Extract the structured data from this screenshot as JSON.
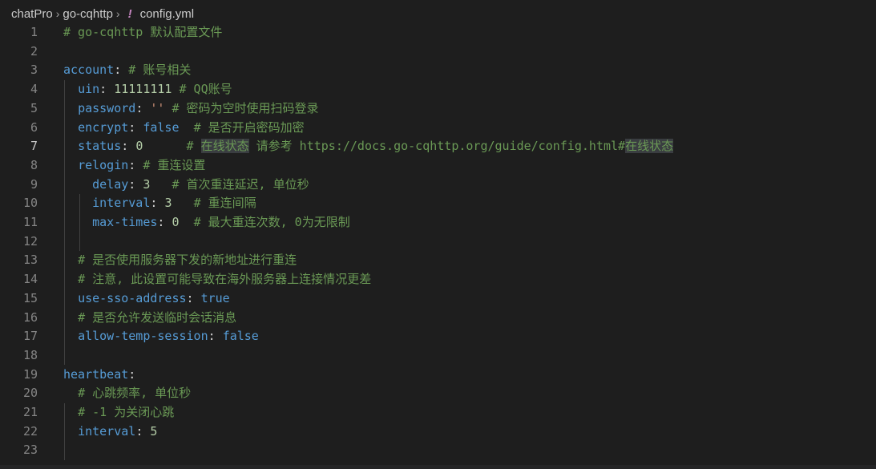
{
  "breadcrumb": {
    "items": [
      "chatPro",
      "go-cqhttp"
    ],
    "file_icon": "!",
    "file": "config.yml"
  },
  "lines": [
    {
      "n": "1",
      "segs": [
        [
          "c",
          "# go-cqhttp 默认配置文件"
        ]
      ]
    },
    {
      "n": "2",
      "segs": []
    },
    {
      "n": "3",
      "segs": [
        [
          "k",
          "account"
        ],
        [
          "p",
          ": "
        ],
        [
          "c",
          "# 账号相关"
        ]
      ]
    },
    {
      "n": "4",
      "segs": [
        [
          "p",
          "  "
        ],
        [
          "k",
          "uin"
        ],
        [
          "p",
          ": "
        ],
        [
          "n",
          "11111111"
        ],
        [
          "p",
          " "
        ],
        [
          "c",
          "# QQ账号"
        ]
      ]
    },
    {
      "n": "5",
      "segs": [
        [
          "p",
          "  "
        ],
        [
          "k",
          "password"
        ],
        [
          "p",
          ": "
        ],
        [
          "s",
          "''"
        ],
        [
          "p",
          " "
        ],
        [
          "c",
          "# 密码为空时使用扫码登录"
        ]
      ]
    },
    {
      "n": "6",
      "segs": [
        [
          "p",
          "  "
        ],
        [
          "k",
          "encrypt"
        ],
        [
          "p",
          ": "
        ],
        [
          "b",
          "false"
        ],
        [
          "p",
          "  "
        ],
        [
          "c",
          "# 是否开启密码加密"
        ]
      ]
    },
    {
      "n": "7",
      "segs": [
        [
          "p",
          "  "
        ],
        [
          "k",
          "status"
        ],
        [
          "p",
          ": "
        ],
        [
          "n",
          "0"
        ],
        [
          "p",
          "      "
        ],
        [
          "c",
          "# "
        ],
        [
          "chl",
          "在线状态"
        ],
        [
          "c",
          " 请参考 https://docs.go-cqhttp.org/guide/config.html#"
        ],
        [
          "chl",
          "在线状态"
        ]
      ]
    },
    {
      "n": "8",
      "segs": [
        [
          "p",
          "  "
        ],
        [
          "k",
          "relogin"
        ],
        [
          "p",
          ": "
        ],
        [
          "c",
          "# 重连设置"
        ]
      ]
    },
    {
      "n": "9",
      "segs": [
        [
          "p",
          "    "
        ],
        [
          "k",
          "delay"
        ],
        [
          "p",
          ": "
        ],
        [
          "n",
          "3"
        ],
        [
          "p",
          "   "
        ],
        [
          "c",
          "# 首次重连延迟, 单位秒"
        ]
      ]
    },
    {
      "n": "10",
      "segs": [
        [
          "p",
          "    "
        ],
        [
          "k",
          "interval"
        ],
        [
          "p",
          ": "
        ],
        [
          "n",
          "3"
        ],
        [
          "p",
          "   "
        ],
        [
          "c",
          "# 重连间隔"
        ]
      ]
    },
    {
      "n": "11",
      "segs": [
        [
          "p",
          "    "
        ],
        [
          "k",
          "max-times"
        ],
        [
          "p",
          ": "
        ],
        [
          "n",
          "0"
        ],
        [
          "p",
          "  "
        ],
        [
          "c",
          "# 最大重连次数, 0为无限制"
        ]
      ]
    },
    {
      "n": "12",
      "segs": []
    },
    {
      "n": "13",
      "segs": [
        [
          "p",
          "  "
        ],
        [
          "c",
          "# 是否使用服务器下发的新地址进行重连"
        ]
      ]
    },
    {
      "n": "14",
      "segs": [
        [
          "p",
          "  "
        ],
        [
          "c",
          "# 注意, 此设置可能导致在海外服务器上连接情况更差"
        ]
      ]
    },
    {
      "n": "15",
      "segs": [
        [
          "p",
          "  "
        ],
        [
          "k",
          "use-sso-address"
        ],
        [
          "p",
          ": "
        ],
        [
          "b",
          "true"
        ]
      ]
    },
    {
      "n": "16",
      "segs": [
        [
          "p",
          "  "
        ],
        [
          "c",
          "# 是否允许发送临时会话消息"
        ]
      ]
    },
    {
      "n": "17",
      "segs": [
        [
          "p",
          "  "
        ],
        [
          "k",
          "allow-temp-session"
        ],
        [
          "p",
          ": "
        ],
        [
          "b",
          "false"
        ]
      ]
    },
    {
      "n": "18",
      "segs": []
    },
    {
      "n": "19",
      "segs": [
        [
          "k",
          "heartbeat"
        ],
        [
          "p",
          ":"
        ]
      ]
    },
    {
      "n": "20",
      "segs": [
        [
          "p",
          "  "
        ],
        [
          "c",
          "# 心跳频率, 单位秒"
        ]
      ]
    },
    {
      "n": "21",
      "segs": [
        [
          "p",
          "  "
        ],
        [
          "c",
          "# -1 为关闭心跳"
        ]
      ]
    },
    {
      "n": "22",
      "segs": [
        [
          "p",
          "  "
        ],
        [
          "k",
          "interval"
        ],
        [
          "p",
          ": "
        ],
        [
          "n",
          "5"
        ]
      ]
    },
    {
      "n": "23",
      "segs": []
    }
  ],
  "active_line": "7"
}
